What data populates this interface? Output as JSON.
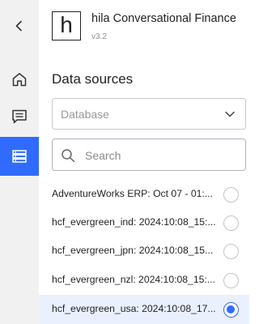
{
  "app": {
    "logo_letter": "h",
    "title": "hila Conversational Finance",
    "version": "v3.2"
  },
  "nav": [
    {
      "name": "collapse",
      "icon": "chevron-left-icon"
    },
    {
      "name": "home",
      "icon": "home-icon"
    },
    {
      "name": "chat",
      "icon": "chat-icon"
    },
    {
      "name": "data-sources",
      "icon": "database-icon",
      "active": true
    }
  ],
  "colors": {
    "accent": "#2f6bff",
    "rail_bg": "#f1f1f1",
    "selected_row_bg": "#eaf0fd"
  },
  "data_sources": {
    "title": "Data sources",
    "select": {
      "placeholder": "Database"
    },
    "search": {
      "placeholder": "Search"
    },
    "items": [
      {
        "label": "AdventureWorks ERP: Oct 07 - 01:...",
        "selected": false
      },
      {
        "label": "hcf_evergreen_ind: 2024:10:08_15:...",
        "selected": false
      },
      {
        "label": "hcf_evergreen_jpn: 2024:10:08_15...",
        "selected": false
      },
      {
        "label": "hcf_evergreen_nzl: 2024:10:08_15:...",
        "selected": false
      },
      {
        "label": "hcf_evergreen_usa: 2024:10:08_17...",
        "selected": true
      }
    ]
  }
}
